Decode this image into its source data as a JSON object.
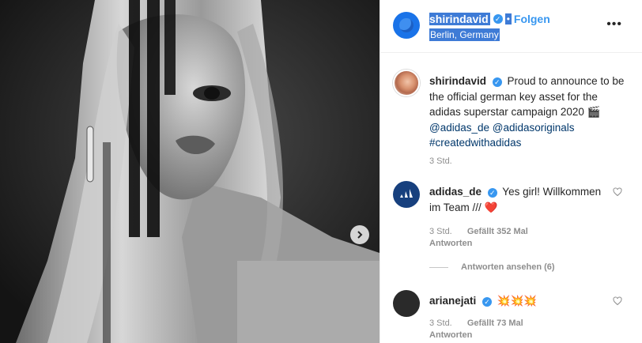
{
  "post": {
    "username": "shirindavid",
    "follow_label": "Folgen",
    "location": "Berlin, Germany",
    "more_label": "•••",
    "separator": "•",
    "verified_icon": "verified-badge-icon"
  },
  "caption": {
    "username": "shirindavid",
    "text": " Proud to announce to be the official german key asset for the adidas superstar campaign 2020 ",
    "emoji": "🎬",
    "mention1": "@adidas_de",
    "mention2": "@adidasoriginals",
    "hashtag": "#createdwithadidas",
    "time": "3 Std."
  },
  "comments": [
    {
      "username": "adidas_de",
      "text": " Yes girl! Willkommen im Team /// ",
      "emoji": "❤️",
      "time": "3 Std.",
      "likes": "Gefällt 352 Mal",
      "reply_label": "Antworten",
      "view_replies": "Antworten ansehen (6)"
    },
    {
      "username": "arianejati",
      "text": " ",
      "emoji": "💥💥💥",
      "time": "3 Std.",
      "likes": "Gefällt 73 Mal",
      "reply_label": "Antworten"
    }
  ],
  "colors": {
    "link_blue": "#3897f0",
    "hashtag_blue": "#00376b",
    "selection": "#3e7bd6",
    "muted": "#8e8e8e"
  }
}
